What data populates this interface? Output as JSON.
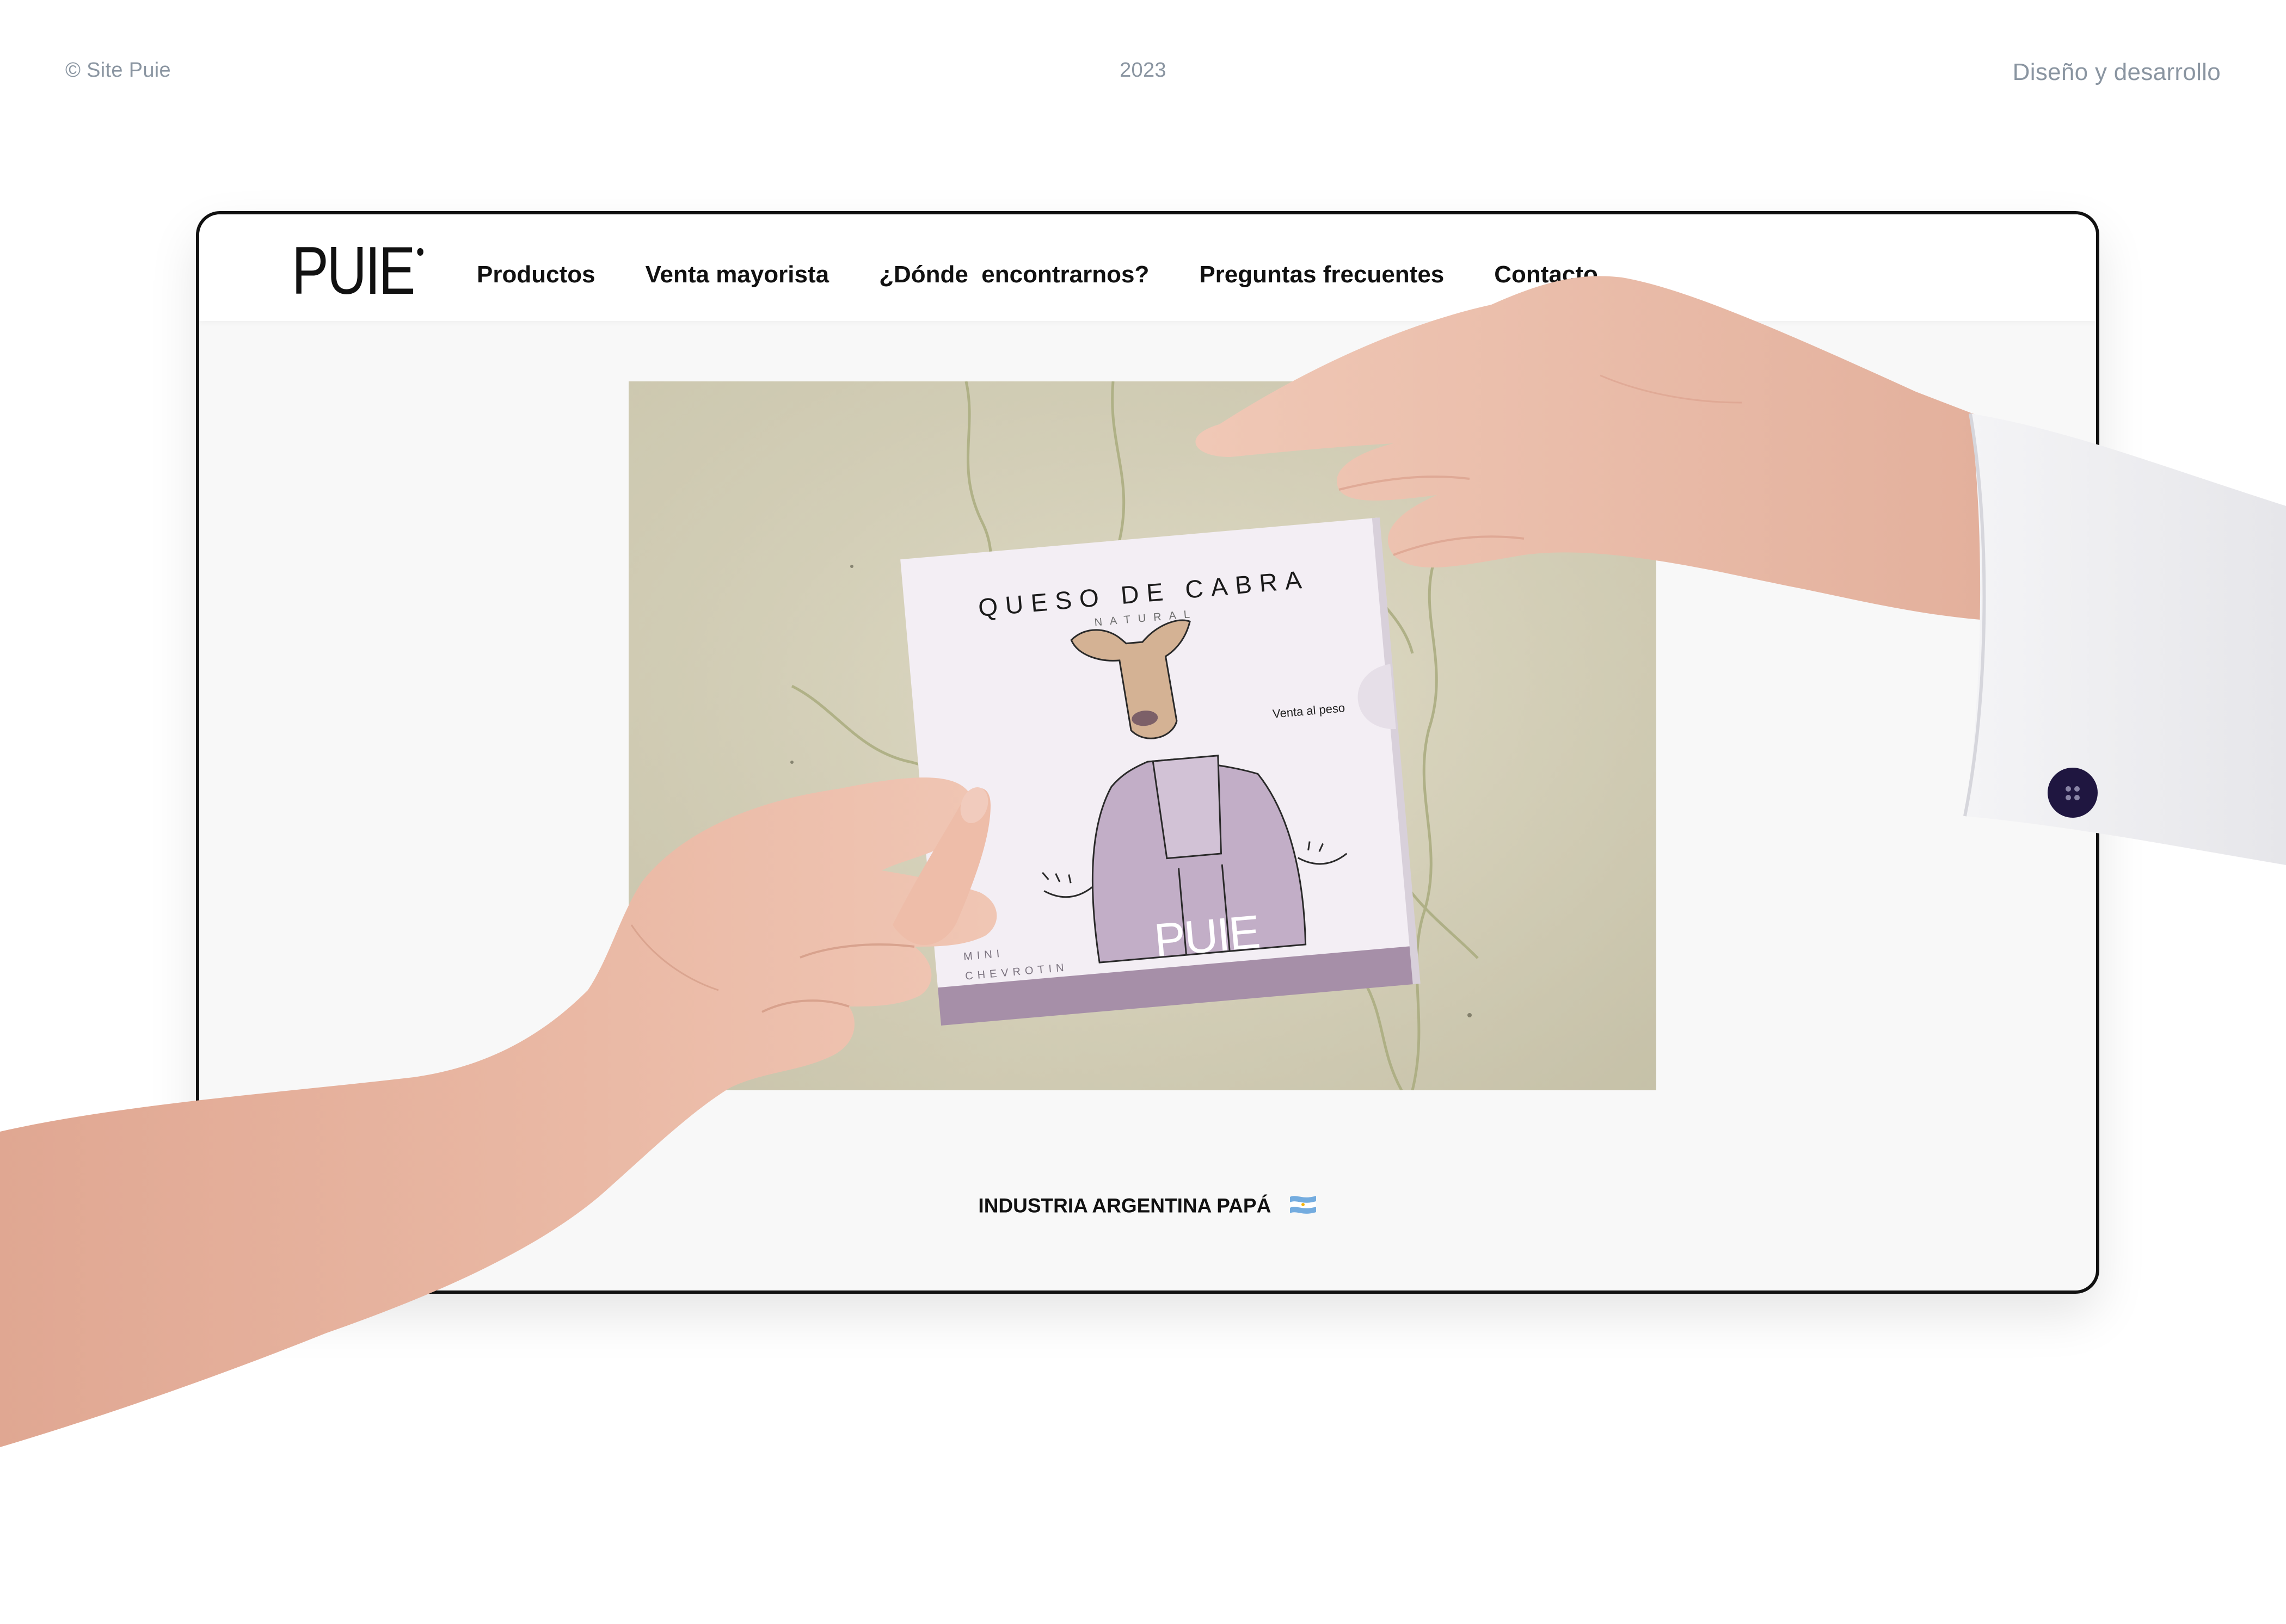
{
  "meta": {
    "left": "© Site Puie",
    "center": "2023",
    "right": "Diseño y desarrollo"
  },
  "site": {
    "logo": "PUIE",
    "nav": [
      "Productos",
      "Venta mayorista",
      "¿Dónde  encontrarnos?",
      "Preguntas frecuentes",
      "Contacto"
    ],
    "tagline": "INDUSTRIA ARGENTINA PAPÁ"
  },
  "product": {
    "title": "QUESO DE CABRA",
    "subtitle": "NATURAL",
    "note": "Venta al peso",
    "mini_line1": "MINI",
    "mini_line2": "CHEVROTIN",
    "brand": "PUIE"
  },
  "colors": {
    "frame_border": "#111111",
    "page_bg": "#ffffff",
    "browser_bg": "#f8f8f8",
    "meta_text": "#8a95a1",
    "box_lilac": "#a68fa8",
    "flag_blue": "#74acdf"
  },
  "icons": {
    "flag": "argentina-flag-icon"
  }
}
